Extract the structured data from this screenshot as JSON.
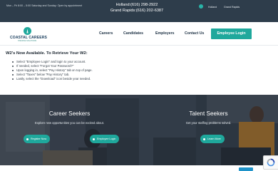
{
  "topbar": {
    "hours": "Mon – Fri 8:00 – 5:00 Saturday and Sunday: Open by appointment",
    "phone_holland": "Holland:(616) 298-2922",
    "phone_gr": "Grand Rapids:(616) 202-6387",
    "location_holland": "Holland",
    "location_gr": "Grand Rapids"
  },
  "logo": {
    "name": "COASTAL CAREERS",
    "tagline": "STAFFING SOLUTIONS"
  },
  "nav": {
    "items": [
      "Careers",
      "Candidates",
      "Employers",
      "Contact Us"
    ],
    "cta": "Employee Login"
  },
  "w2": {
    "heading": "W2's Now Available. To Retrieve Your W2:",
    "steps": [
      "Select \"Employee Login\" and login to your account.",
      "If needed, select \"Forgot Your Password?\"",
      "Upon logging in, select \"Pay History\" tab on top of page.",
      "Select \"Taxes\" below \"Pay History\" tab.",
      "Lastly, select the \"Download\" icon beside year needed."
    ]
  },
  "panels": {
    "left": {
      "title": "Career Seekers",
      "subtitle": "Explore new opportunities you can be excited about.",
      "button1": "Register Now",
      "button2": "Employee Login"
    },
    "right": {
      "title": "Talent Seekers",
      "subtitle": "Get your staffing problems solved.",
      "button1": "Learn More"
    }
  },
  "colors": {
    "teal": "#1fa89c",
    "navy": "#2e3d4b",
    "heading": "#173c5c"
  }
}
